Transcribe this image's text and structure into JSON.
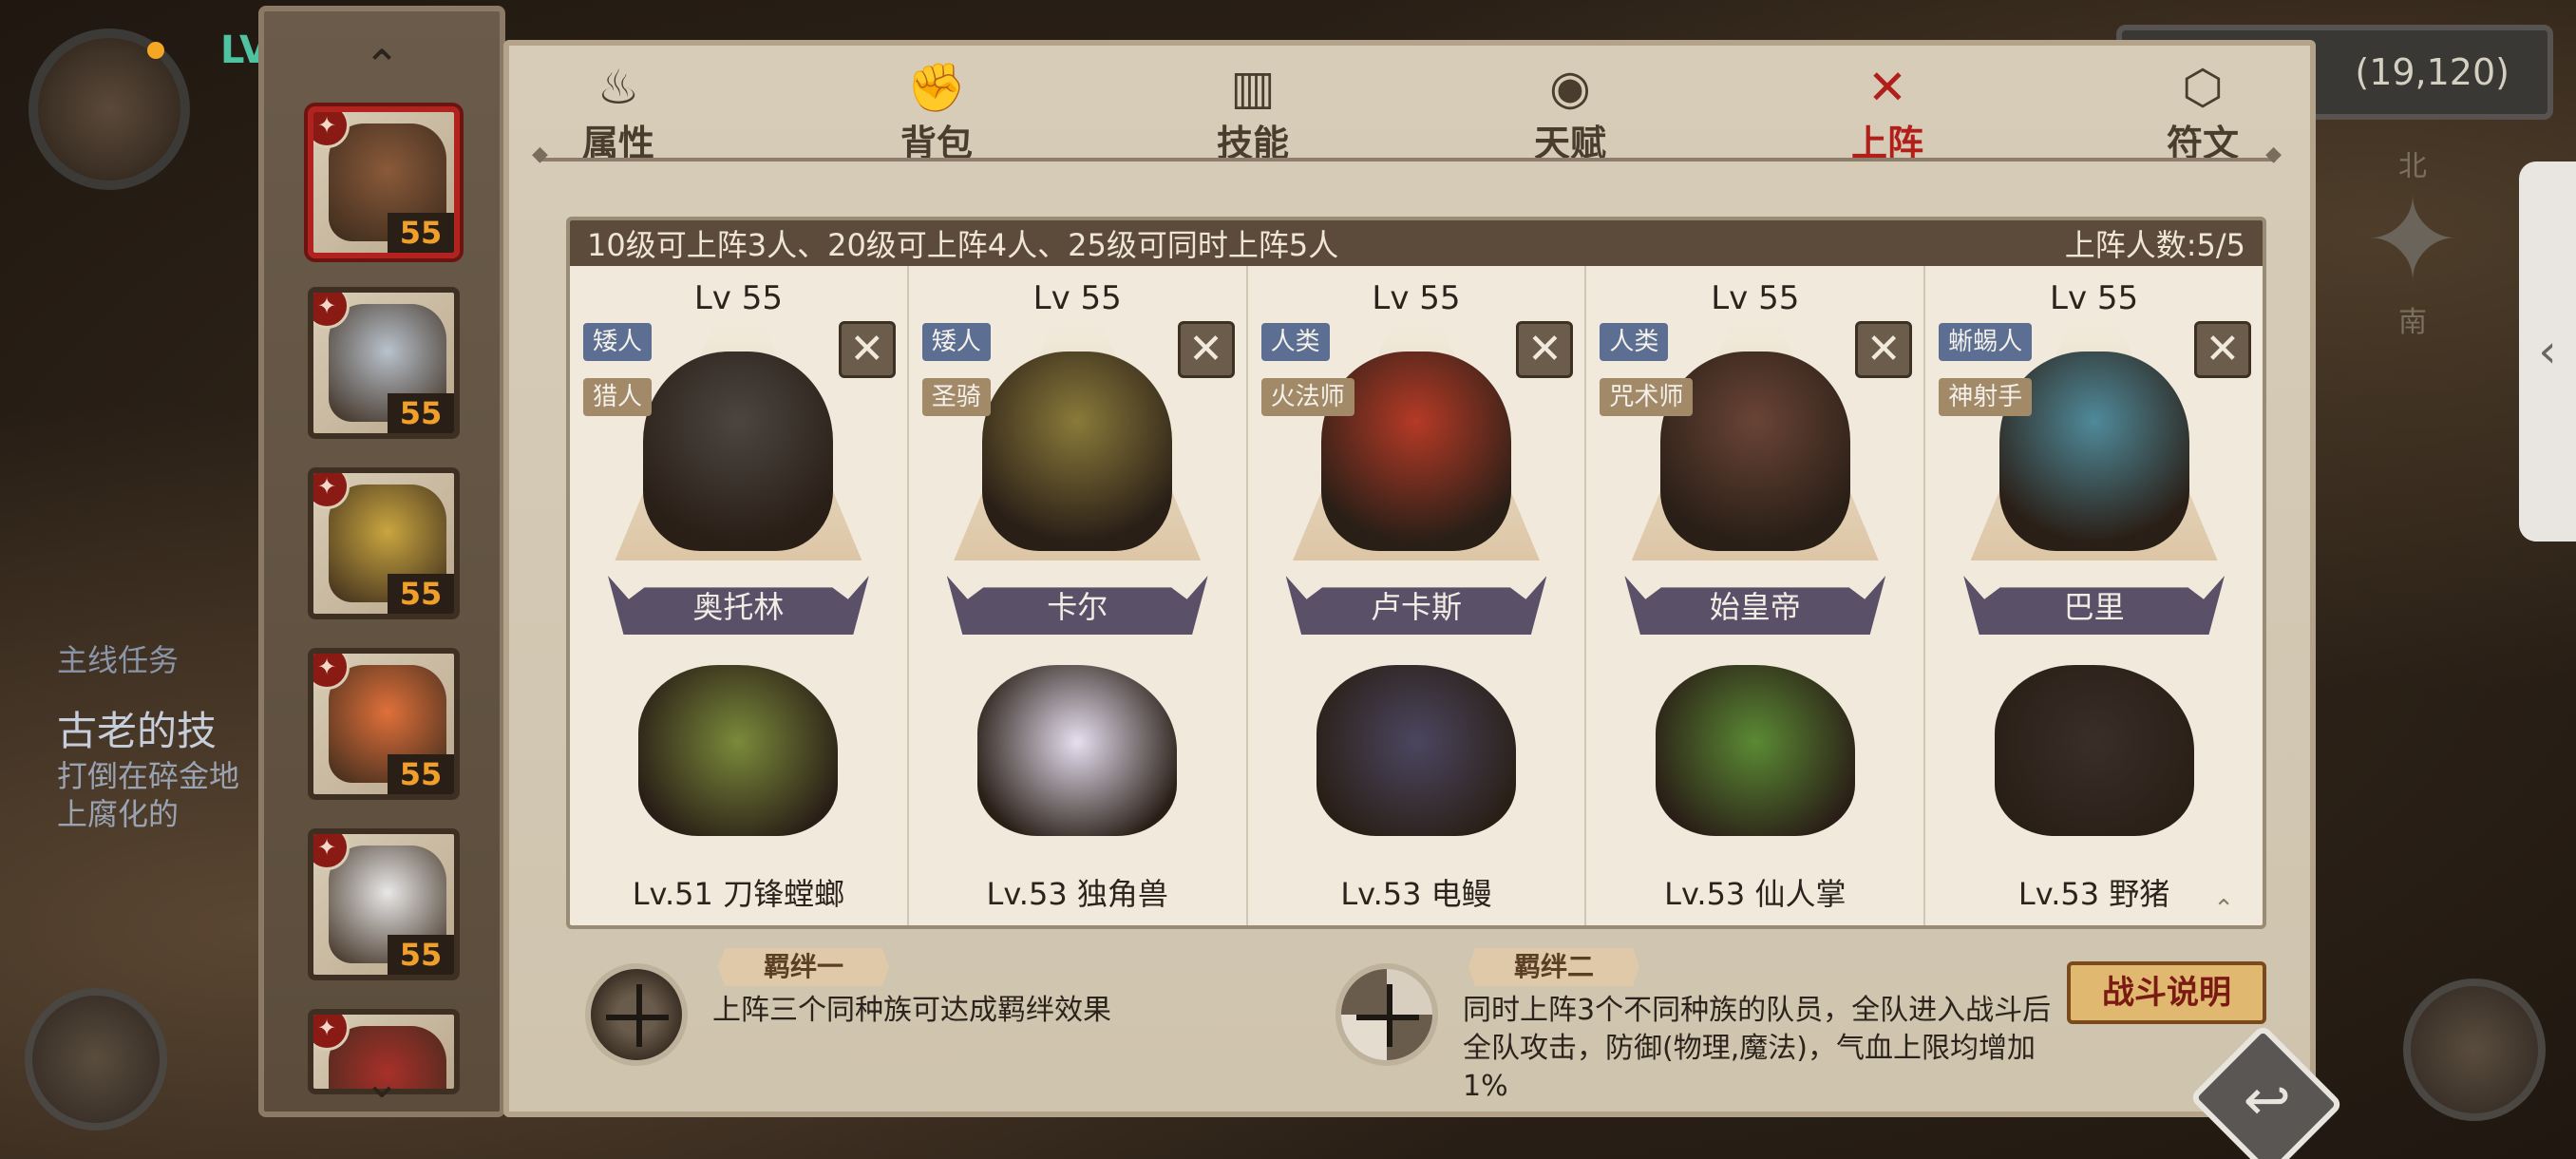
{
  "hud": {
    "level_prefix": "LV",
    "coordinates": "(19,120)",
    "compass_north": "北",
    "compass_south": "南",
    "side_handle_icon": "chevron-left-icon",
    "quest_header": "主线任务",
    "quest_title": "古老的技",
    "quest_text": "打倒在碎金地上腐化的"
  },
  "tabs": [
    {
      "label": "属性",
      "icon": "attributes-icon"
    },
    {
      "label": "背包",
      "icon": "backpack-icon"
    },
    {
      "label": "技能",
      "icon": "skill-book-icon"
    },
    {
      "label": "天赋",
      "icon": "talent-eye-icon"
    },
    {
      "label": "上阵",
      "icon": "crossed-swords-icon",
      "active": true
    },
    {
      "label": "符文",
      "icon": "rune-icon"
    }
  ],
  "formation": {
    "rule_text": "10级可上阵3人、20级可上阵4人、25级可同时上阵5人",
    "count_text": "上阵人数:5/5",
    "slots": [
      {
        "level": "Lv 55",
        "race": "矮人",
        "class": "猎人",
        "name": "奥托林",
        "pet": "Lv.51 刀锋螳螂",
        "hero_color": "#4b4540",
        "pet_color": "#7a8a3a"
      },
      {
        "level": "Lv 55",
        "race": "矮人",
        "class": "圣骑",
        "name": "卡尔",
        "pet": "Lv.53 独角兽",
        "hero_color": "#8a7a3a",
        "pet_color": "#e6dff0"
      },
      {
        "level": "Lv 55",
        "race": "人类",
        "class": "火法师",
        "name": "卢卡斯",
        "pet": "Lv.53 电鳗",
        "hero_color": "#b53a26",
        "pet_color": "#4b4660"
      },
      {
        "level": "Lv 55",
        "race": "人类",
        "class": "咒术师",
        "name": "始皇帝",
        "pet": "Lv.53 仙人掌",
        "hero_color": "#6a4436",
        "pet_color": "#5b8a34"
      },
      {
        "level": "Lv 55",
        "race": "蜥蜴人",
        "class": "神射手",
        "name": "巴里",
        "pet": "Lv.53 野猪",
        "hero_color": "#4f8a9a",
        "pet_color": "#3a2e28"
      }
    ]
  },
  "bonds": [
    {
      "title": "羁绊一",
      "desc": "上阵三个同种族可达成羁绊效果"
    },
    {
      "title": "羁绊二",
      "desc": "同时上阵3个不同种族的队员，全队进入战斗后全队攻击，防御(物理,魔法)，气血上限均增加1%"
    }
  ],
  "buttons": {
    "battle_info": "战斗说明",
    "remove": "✕",
    "back_icon": "return-arrow-icon"
  },
  "roster": [
    {
      "level": "55",
      "selected": true,
      "color": "#8a5a3a"
    },
    {
      "level": "55",
      "selected": false,
      "color": "#b9c2cc"
    },
    {
      "level": "55",
      "selected": false,
      "color": "#c9a640"
    },
    {
      "level": "55",
      "selected": false,
      "color": "#e0703a"
    },
    {
      "level": "55",
      "selected": false,
      "color": "#e8e8e8"
    },
    {
      "level": "",
      "selected": false,
      "color": "#a8302a"
    }
  ]
}
